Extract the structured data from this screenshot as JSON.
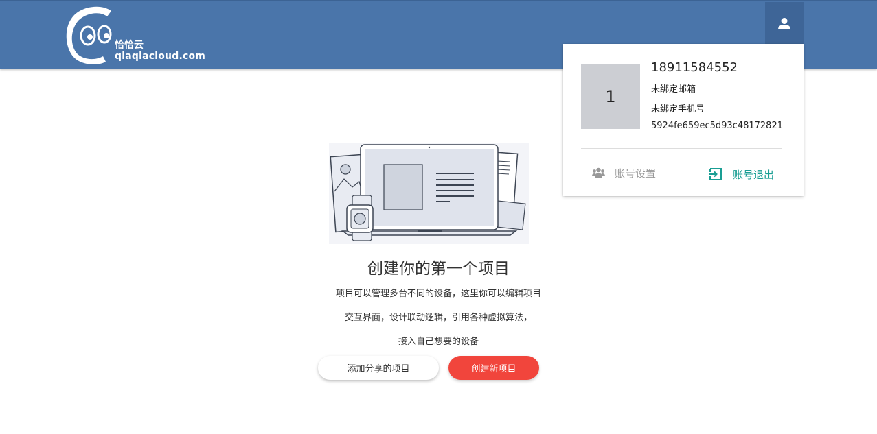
{
  "header": {
    "logo_cn": "恰恰云",
    "logo_en": "qiaqiacloud.com",
    "user_icon": "person-icon"
  },
  "user_panel": {
    "avatar_text": "1",
    "phone": "18911584552",
    "email_status": "未绑定邮箱",
    "phone_status": "未绑定手机号",
    "user_id": "5924fe659ec5d93c48172821",
    "settings_label": "账号设置",
    "settings_icon": "group-icon",
    "logout_label": "账号退出",
    "logout_icon": "exit-icon"
  },
  "main": {
    "title": "创建你的第一个项目",
    "desc_lines": [
      "项目可以管理多台不同的设备，这里你可以编辑项目",
      "交互界面，设计联动逻辑，引用各种虚拟算法，",
      "接入自己想要的设备"
    ],
    "share_button": "添加分享的项目",
    "create_button": "创建新项目"
  },
  "colors": {
    "header_bg": "#4a75aa",
    "accent_teal": "#1a9e94",
    "create_red": "#f1453c"
  }
}
